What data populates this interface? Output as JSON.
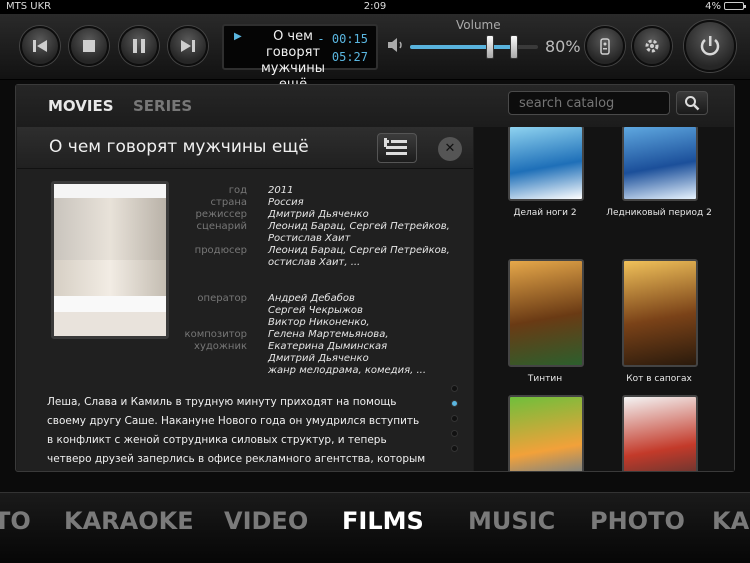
{
  "status": {
    "carrier": "MTS UKR",
    "time": "2:09",
    "battery": "4%"
  },
  "player": {
    "now_playing_title": "О чем говорят мужчины ещё",
    "elapsed": "- 00:15",
    "total": "05:27",
    "volume_label": "Volume",
    "volume_percent": "80%",
    "volume_level": 0.8
  },
  "tabs": [
    {
      "label": "MOVIES",
      "active": true
    },
    {
      "label": "SERIES",
      "active": false
    }
  ],
  "search": {
    "placeholder": "search catalog"
  },
  "film": {
    "title": "О чем говорят мужчины ещё",
    "labels": {
      "year": "год",
      "country": "страна",
      "director": "режиссер",
      "writer": "сценарий",
      "producer": "продюсер",
      "operator": "оператор",
      "composer": "композитор",
      "artist": "художник"
    },
    "values": {
      "year": "2011",
      "country": "Россия",
      "director": "Дмитрий Дьяченко",
      "writer_1": "Леонид Барац, Сергей Петрейков,",
      "writer_2": "Ростислав Хаит",
      "producer_1": "Леонид Барац, Сергей Петрейков,",
      "producer_2": "остислав Хаит, ...",
      "operator": "Андрей Дебабов",
      "composer": "Сергей Чекрыжов",
      "artist_1": "Виктор Никоненко,",
      "artist_2": "Гелена Мартемьянова,",
      "artist_3": " Екатерина Дыминская",
      "artist_4": "Дмитрий Дьяченко",
      "genre": "жанр мелодрама, комедия, ..."
    },
    "description": "Леша, Слава и Камиль в трудную минуту приходят на помощь своему другу Саше. Накануне Нового года он умудрился вступить в конфликт с женой сотрудника силовых структур, и теперь четверо друзей заперлись в офисе рекламного агентства, которым руководит Саша, пытаясь придумать выход из сложившейся ситуации и коротая время в мужских разговорах."
  },
  "catalog": [
    {
      "caption": "Делай ноги 2",
      "colors": [
        "#8fd3f0",
        "#1e6fb8",
        "#ffffff"
      ]
    },
    {
      "caption": "Ледниковый период 2",
      "colors": [
        "#5fa8e0",
        "#1b4f9a",
        "#e8f4ff"
      ]
    },
    {
      "caption": "Тинтин",
      "colors": [
        "#e6a84a",
        "#6a3a14",
        "#2c5f2d"
      ]
    },
    {
      "caption": "Кот в сапогах",
      "colors": [
        "#f0c15a",
        "#7a4218",
        "#2a1a0c"
      ]
    },
    {
      "caption": "",
      "colors": [
        "#6fbf3b",
        "#f2a13a",
        "#2d6fb5"
      ]
    },
    {
      "caption": "",
      "colors": [
        "#f4f4f4",
        "#c33a2a",
        "#333333"
      ]
    }
  ],
  "categories": [
    {
      "label": "TO",
      "active": false
    },
    {
      "label": "KARAOKE",
      "active": false
    },
    {
      "label": "VIDEO",
      "active": false
    },
    {
      "label": "FILMS",
      "active": true
    },
    {
      "label": "MUSIC",
      "active": false
    },
    {
      "label": "PHOTO",
      "active": false
    },
    {
      "label": "KA",
      "active": false
    }
  ],
  "accent": "#5ab6e0"
}
